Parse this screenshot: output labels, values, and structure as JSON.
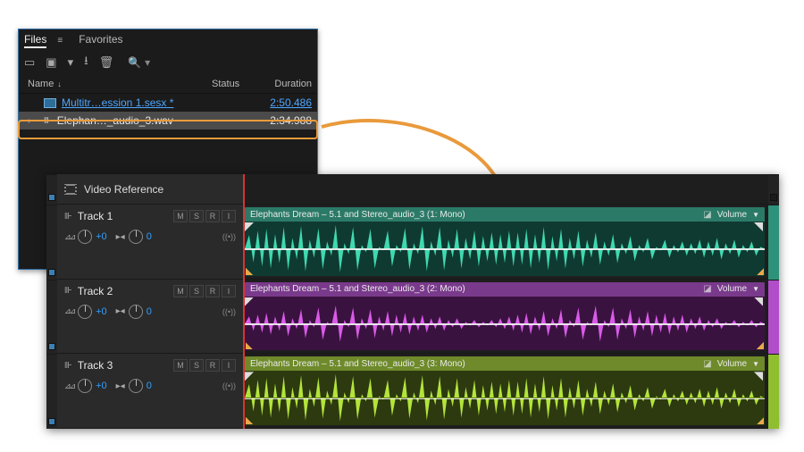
{
  "accent_orange": "#e99a3c",
  "files_panel": {
    "tabs": [
      {
        "label": "Files",
        "active": true
      },
      {
        "label": "Favorites",
        "active": false
      }
    ],
    "toolbar_icons": [
      "open-folder-icon",
      "import-icon",
      "new-file-icon",
      "save-icon",
      "trash-icon",
      "search-icon"
    ],
    "columns": {
      "name": "Name",
      "status": "Status",
      "duration": "Duration"
    },
    "rows": [
      {
        "kind": "session",
        "icon": "sesx-icon",
        "name": "Multitr…ession 1.sesx *",
        "status": "",
        "duration": "2:50.486",
        "selected": false,
        "expandable": false
      },
      {
        "kind": "audio",
        "icon": "audio-icon",
        "name": "Elephan…_audio_3.wav",
        "status": "",
        "duration": "2:34.988",
        "selected": true,
        "expandable": true
      }
    ]
  },
  "editor": {
    "video_reference_label": "Video Reference",
    "track_buttons": {
      "m": "M",
      "s": "S",
      "r": "R",
      "i": "I"
    },
    "knob_zero": "+0",
    "pan_zero": "0",
    "volume_label": "Volume",
    "tracks": [
      {
        "name": "Track 1",
        "color": "teal",
        "clip_title": "Elephants Dream – 5.1 and Stereo_audio_3 (1: Mono)"
      },
      {
        "name": "Track 2",
        "color": "purple",
        "clip_title": "Elephants Dream – 5.1 and Stereo_audio_3 (2: Mono)"
      },
      {
        "name": "Track 3",
        "color": "lime",
        "clip_title": "Elephants Dream – 5.1 and Stereo_audio_3 (3: Mono)"
      }
    ]
  }
}
